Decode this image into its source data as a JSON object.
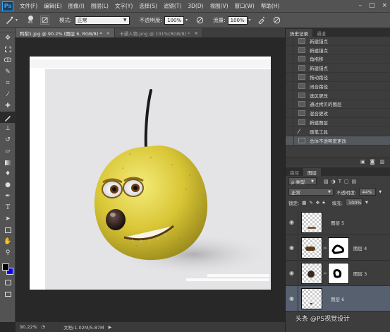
{
  "menubar": {
    "logo": "Ps",
    "items": [
      "文件(F)",
      "编辑(E)",
      "图像(I)",
      "图层(L)",
      "文字(Y)",
      "选择(S)",
      "滤镜(T)",
      "3D(D)",
      "视图(V)",
      "窗口(W)",
      "帮助(H)"
    ],
    "window_controls": [
      "–",
      "□",
      "×"
    ]
  },
  "options": {
    "brush_size": "45",
    "mode_label": "模式:",
    "mode_value": "正常",
    "opacity_label": "不透明度:",
    "opacity_value": "100%",
    "flow_label": "流量:",
    "flow_value": "100%"
  },
  "doc_tabs": [
    {
      "label": "鸭梨1.jpg @ 90.2% (图层 6, RGB/8) *",
      "close": "×"
    },
    {
      "label": "卡通人物.png @ 101%(RGB/8) *",
      "close": "×"
    }
  ],
  "status": {
    "zoom": "90.22%",
    "doc_info": "文档:1.02M/5.87M",
    "watermark": "头条 @PS视觉设计"
  },
  "history_panel": {
    "tabs": [
      "历史记录",
      "通道"
    ],
    "items": [
      "新建锚点",
      "新建锚点",
      "角拖移",
      "新建锚点",
      "拖动路径",
      "闭合路径",
      "选区更改",
      "通过拷贝的图层",
      "混合更改",
      "新建图层",
      "画笔工具",
      "总体不透明度更改"
    ]
  },
  "layers_panel": {
    "tabs": [
      "路径",
      "图层"
    ],
    "filter_label": "ρ 类型",
    "blend_mode": "正常",
    "opacity_label": "不透明度:",
    "opacity_value": "44%",
    "lock_label": "锁定:",
    "fill_label": "填充:",
    "fill_value": "100%",
    "layers": [
      {
        "name": "图层 5",
        "has_mask": false
      },
      {
        "name": "图层 4",
        "has_mask": true
      },
      {
        "name": "图层 3",
        "has_mask": true
      },
      {
        "name": "图层 6",
        "has_mask": false
      }
    ]
  },
  "colors": {
    "foreground": "#000000",
    "background": "#0000ff",
    "accent": "#31a8ff",
    "selected_row": "#56606e"
  }
}
